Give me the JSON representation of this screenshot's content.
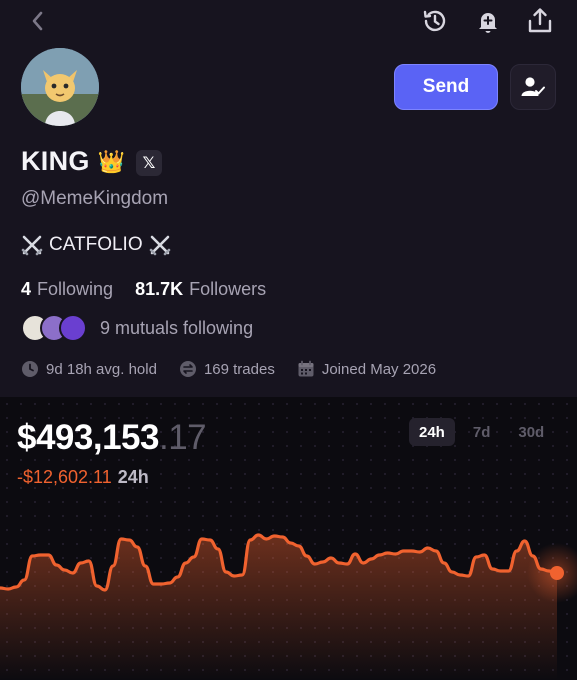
{
  "profile": {
    "name": "KING",
    "crown_emoji": "👑",
    "x_badge": "𝕏",
    "handle": "@MemeKingdom",
    "bio_text": "CATFOLIO",
    "following_count": "4",
    "following_label": "Following",
    "followers_count": "81.7K",
    "followers_label": "Followers",
    "mutuals_text": "9 mutuals following",
    "avg_hold": "9d 18h avg. hold",
    "trades": "169 trades",
    "joined": "Joined May 2026"
  },
  "actions": {
    "send_label": "Send"
  },
  "portfolio": {
    "value_main": "$493,153",
    "value_decimal": ".17",
    "change_value": "-$12,602.11",
    "change_period": "24h",
    "ranges": [
      "24h",
      "7d",
      "30d"
    ],
    "active_range": "24h"
  },
  "colors": {
    "accent": "#5a63f5",
    "line": "#f0622f",
    "negative": "#f0622f"
  },
  "chart_data": {
    "type": "area",
    "y": [
      47,
      46,
      48,
      55,
      79,
      80,
      80,
      70,
      65,
      62,
      72,
      74,
      49,
      45,
      69,
      96,
      95,
      88,
      69,
      51,
      51,
      52,
      58,
      72,
      78,
      96,
      95,
      86,
      63,
      59,
      60,
      95,
      100,
      96,
      99,
      98,
      92,
      89,
      79,
      71,
      73,
      77,
      72,
      71,
      81,
      72,
      76,
      80,
      82,
      81,
      84,
      84,
      83,
      87,
      84,
      72,
      63,
      60,
      59,
      78,
      80,
      66,
      64,
      64,
      84,
      94,
      79,
      66,
      64,
      62
    ]
  }
}
